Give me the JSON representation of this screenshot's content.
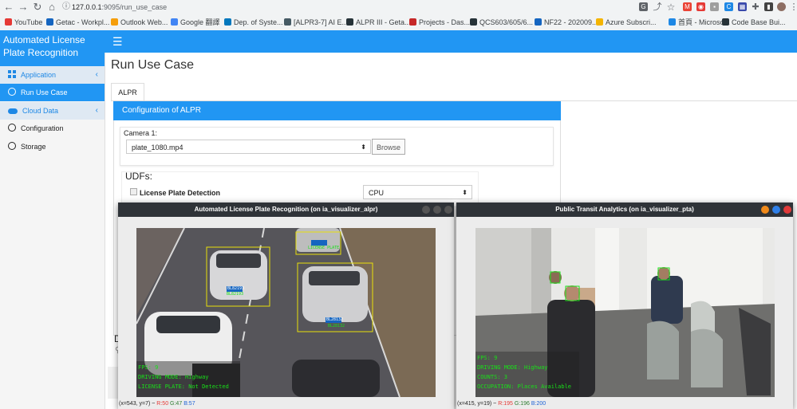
{
  "browser": {
    "url_host": "127.0.0.1",
    "url_path": ":9095/run_use_case",
    "bookmarks": [
      {
        "label": "YouTube",
        "color": "#e53935"
      },
      {
        "label": "Getac - Workpl...",
        "color": "#1565c0"
      },
      {
        "label": "Outlook Web...",
        "color": "#f59e0b"
      },
      {
        "label": "Google 翻譯",
        "color": "#4285f4"
      },
      {
        "label": "Dep. of Syste...",
        "color": "#0277bd"
      },
      {
        "label": "[ALPR3-7] AI E...",
        "color": "#455a64"
      },
      {
        "label": "ALPR III - Geta...",
        "color": "#263238"
      },
      {
        "label": "Projects - Das...",
        "color": "#c62828"
      },
      {
        "label": "QCS603/605/6...",
        "color": "#263238"
      },
      {
        "label": "NF22 - 202009...",
        "color": "#1565c0"
      },
      {
        "label": "Azure Subscri...",
        "color": "#f4b400"
      },
      {
        "label": "首頁 - Microso...",
        "color": "#1e88e5"
      },
      {
        "label": "Code Base Bui...",
        "color": "#263238"
      }
    ]
  },
  "sidebar": {
    "brand": "Automated License Plate Recognition",
    "items": [
      {
        "label": "Application",
        "kind": "group",
        "icon": "grid-icon"
      },
      {
        "label": "Run Use Case",
        "kind": "active",
        "icon": "circle-icon"
      },
      {
        "label": "Cloud Data",
        "kind": "group",
        "icon": "cloud-icon"
      },
      {
        "label": "Configuration",
        "kind": "plain",
        "icon": "circle-icon"
      },
      {
        "label": "Storage",
        "kind": "plain",
        "icon": "circle-icon"
      }
    ]
  },
  "page": {
    "title": "Run Use Case",
    "tab": "ALPR",
    "panel_title": "Configuration of ALPR",
    "camera_label": "Camera 1:",
    "camera_value": "plate_1080.mp4",
    "browse_label": "Browse",
    "udfs_label": "UDFs:",
    "udf_name": "License Plate Detection",
    "udf_device": "CPU",
    "partial_d": "D"
  },
  "windows": {
    "alpr": {
      "title": "Automated License Plate Recognition (on ia_visualizer_alpr)",
      "overlay": [
        "FPS: 9",
        "DRIVING MODE: Highway",
        "LICENSE PLATE: Not Detected"
      ],
      "plates": [
        "LICENSE PLATE",
        "BL82193",
        "BL82193",
        "BL28132",
        "BL28132"
      ],
      "status_coord": "(x=543, y=7) ~",
      "status_r": "R:50",
      "status_g": "G:47",
      "status_b": "B:57"
    },
    "pta": {
      "title": "Public Transit Analytics (on ia_visualizer_pta)",
      "overlay": [
        "FPS: 9",
        "DRIVING MODE: Highway",
        "COUNTS: 3",
        "OCCUPATION: Places Available"
      ],
      "status_coord": "(x=415, y=19) ~",
      "status_r": "R:195",
      "status_g": "G:196",
      "status_b": "B:200"
    }
  }
}
